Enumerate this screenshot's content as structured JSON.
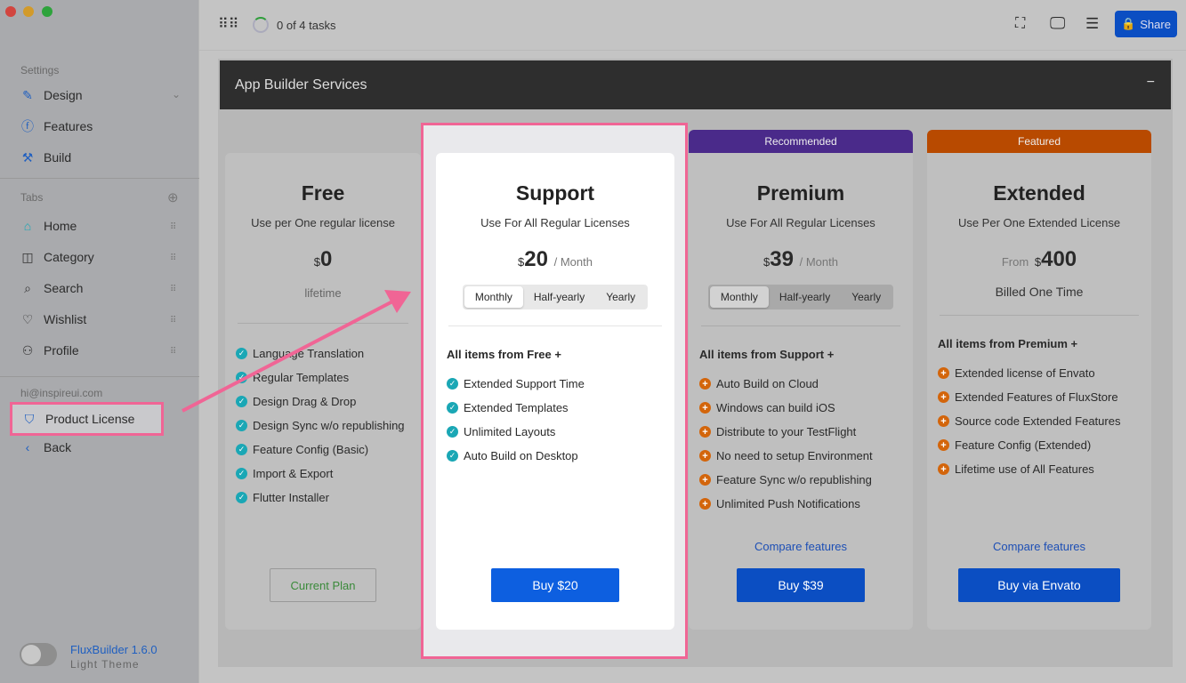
{
  "window": {
    "controls": [
      "close",
      "minimize",
      "zoom"
    ]
  },
  "sidebar": {
    "settings_label": "Settings",
    "settings": [
      {
        "label": "Design",
        "icon": "brush-icon"
      },
      {
        "label": "Features",
        "icon": "bolt-icon"
      },
      {
        "label": "Build",
        "icon": "hammer-icon"
      }
    ],
    "tabs_label": "Tabs",
    "tabs": [
      {
        "label": "Home",
        "icon": "home-icon"
      },
      {
        "label": "Category",
        "icon": "category-icon"
      },
      {
        "label": "Search",
        "icon": "search-icon"
      },
      {
        "label": "Wishlist",
        "icon": "heart-icon"
      },
      {
        "label": "Profile",
        "icon": "user-icon"
      }
    ],
    "email": "hi@inspireui.com",
    "product_license": "Product License",
    "back": "Back",
    "app_name": "FluxBuilder 1.6.0",
    "theme": "Light Theme"
  },
  "topbar": {
    "tasks": "0 of 4 tasks",
    "share": "Share"
  },
  "panel": {
    "title": "App Builder Services",
    "collapse": "−"
  },
  "plans": [
    {
      "name": "Free",
      "sub": "Use per One regular license",
      "currency": "$",
      "price": "0",
      "note": "lifetime",
      "features": [
        "Language Translation",
        "Regular Templates",
        "Design Drag & Drop",
        "Design Sync w/o republishing",
        "Feature Config (Basic)",
        "Import & Export",
        "Flutter Installer"
      ],
      "button": "Current Plan"
    },
    {
      "name": "Support",
      "sub": "Use For All Regular Licenses",
      "currency": "$",
      "price": "20",
      "per": "/ Month",
      "periods": [
        "Monthly",
        "Half-yearly",
        "Yearly"
      ],
      "selected": "Monthly",
      "group": "All items from Free  +",
      "features": [
        "Extended Support Time",
        "Extended Templates",
        "Unlimited Layouts",
        "Auto Build on Desktop"
      ],
      "button": "Buy $20"
    },
    {
      "badge": "Recommended",
      "name": "Premium",
      "sub": "Use For All Regular Licenses",
      "currency": "$",
      "price": "39",
      "per": "/ Month",
      "periods": [
        "Monthly",
        "Half-yearly",
        "Yearly"
      ],
      "selected": "Monthly",
      "group": "All items from Support  +",
      "features": [
        "Auto Build on Cloud",
        "Windows can build iOS",
        "Distribute to your TestFlight",
        "No need to setup Environment",
        "Feature Sync w/o republishing",
        "Unlimited Push Notifications"
      ],
      "compare": "Compare features",
      "button": "Buy $39"
    },
    {
      "badge": "Featured",
      "name": "Extended",
      "sub": "Use Per One Extended License",
      "from": "From",
      "currency": "$",
      "price": "400",
      "note": "Billed One Time",
      "group": "All items from Premium +",
      "features": [
        "Extended license of Envato",
        "Extended Features of FluxStore",
        "Source code Extended Features",
        "Feature Config (Extended)",
        "Lifetime use of All Features"
      ],
      "compare": "Compare features",
      "button": "Buy via Envato"
    }
  ],
  "colors": {
    "accent": "#0b4ec2",
    "highlight": "#f06595",
    "recommended": "#4a2a8a",
    "featured": "#b84a00",
    "check": "#1aa7b5",
    "plus": "#d3650b"
  }
}
